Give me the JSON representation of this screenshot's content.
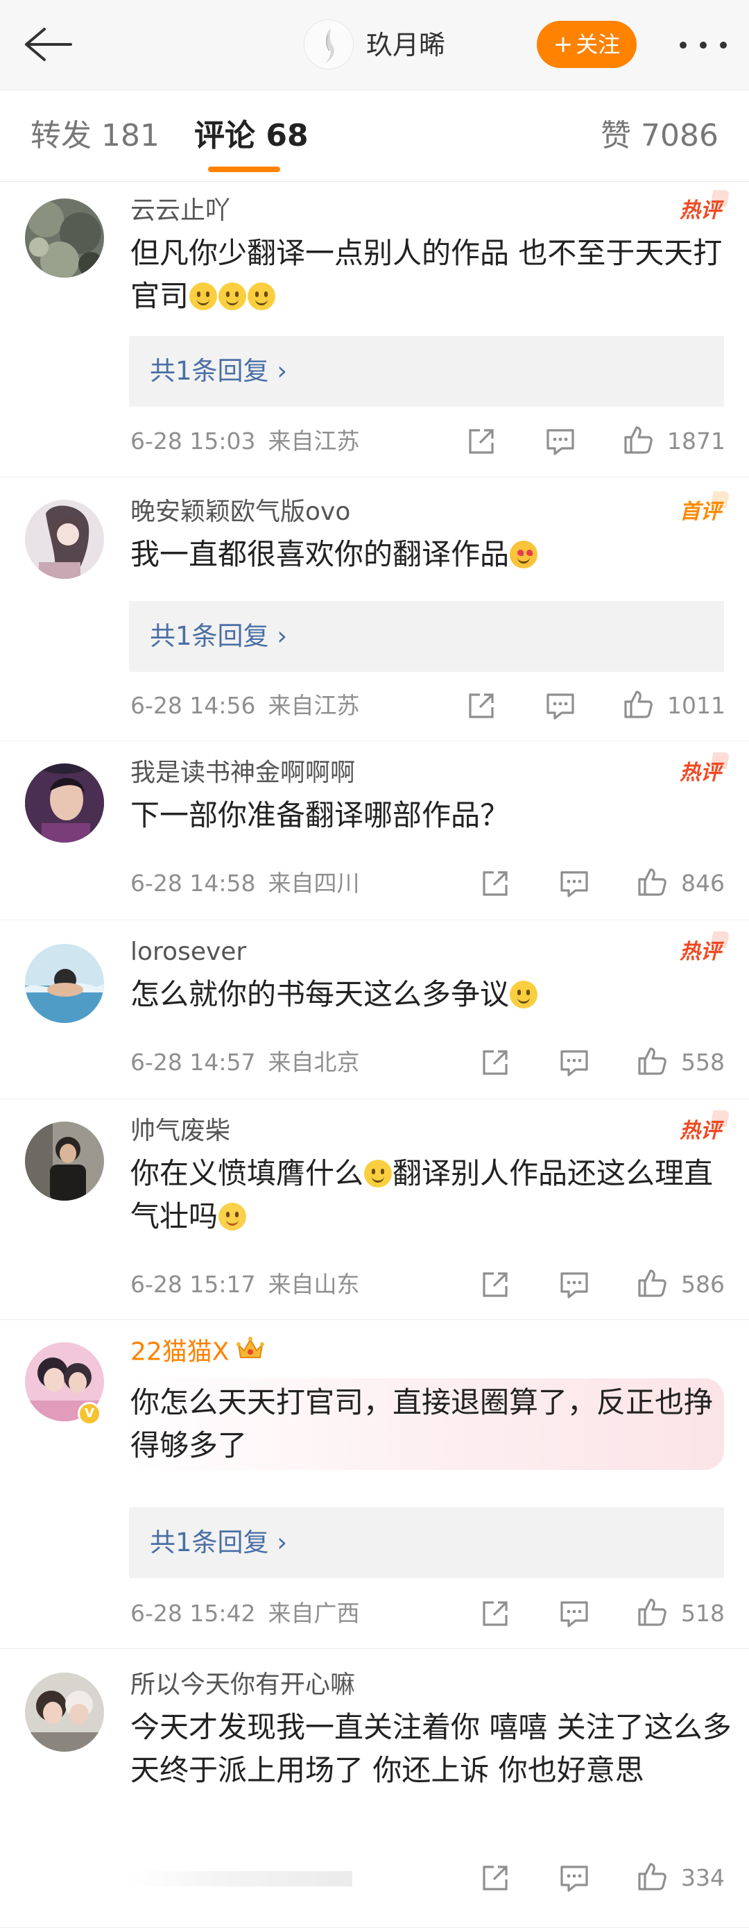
{
  "header": {
    "back_icon": "arrow-left-icon",
    "user_name": "玖月晞",
    "follow_plus": "+",
    "follow_label": "关注",
    "more_icon": "more-dots-icon",
    "accent_color": "#ff8200"
  },
  "tabs": [
    {
      "label": "转发",
      "count": "181"
    },
    {
      "label": "评论",
      "count": "68"
    },
    {
      "label": "赞",
      "count": "7086"
    }
  ],
  "comments": [
    {
      "name": "云云止吖",
      "badge": "热评",
      "text": "但凡你少翻译一点别人的作品 也不至于天天打官司",
      "emojis": 3,
      "reply_label": "共1条回复 ›",
      "time": "6-28 15:03",
      "location": "来自江苏",
      "likes": "1871"
    },
    {
      "name": "晚安颖颖欧气版ovo",
      "badge": "首评",
      "text": "我一直都很喜欢你的翻译作品",
      "emojis": 1,
      "reply_label": "共1条回复 ›",
      "time": "6-28 14:56",
      "location": "来自江苏",
      "likes": "1011"
    },
    {
      "name": "我是读书神金啊啊啊",
      "badge": "热评",
      "text": "下一部你准备翻译哪部作品？",
      "time": "6-28 14:58",
      "location": "来自四川",
      "likes": "846"
    },
    {
      "name": "lorosever",
      "badge": "热评",
      "text": "怎么就你的书每天这么多争议",
      "emojis": 1,
      "time": "6-28 14:57",
      "location": "来自北京",
      "likes": "558"
    },
    {
      "name": "帅气废柴",
      "badge": "热评",
      "text_a": "你在义愤填膺什么",
      "text_b": "翻译别人作品还这么理直气壮吗",
      "time": "6-28 15:17",
      "location": "来自山东",
      "likes": "586"
    },
    {
      "name": "22猫猫X",
      "crown_icon": "crown-icon",
      "verified_icon": "verified-badge-icon",
      "text": "你怎么天天打官司，直接退圈算了，反正也挣得够多了",
      "reply_label": "共1条回复 ›",
      "time": "6-28 15:42",
      "location": "来自广西",
      "likes": "518"
    },
    {
      "name": "所以今天你有开心嘛",
      "text": "今天才发现我一直关注着你 嘻嘻 关注了这么多天终于派上用场了 你还上诉 你也好意思",
      "likes": "334"
    }
  ],
  "action_icons": [
    "share-icon",
    "comment-icon",
    "like-icon"
  ],
  "colors": {
    "link": "#4a6fa5",
    "hot_badge": "#f04a23",
    "first_badge": "#ff8a00",
    "vip_name": "#ff8200"
  }
}
